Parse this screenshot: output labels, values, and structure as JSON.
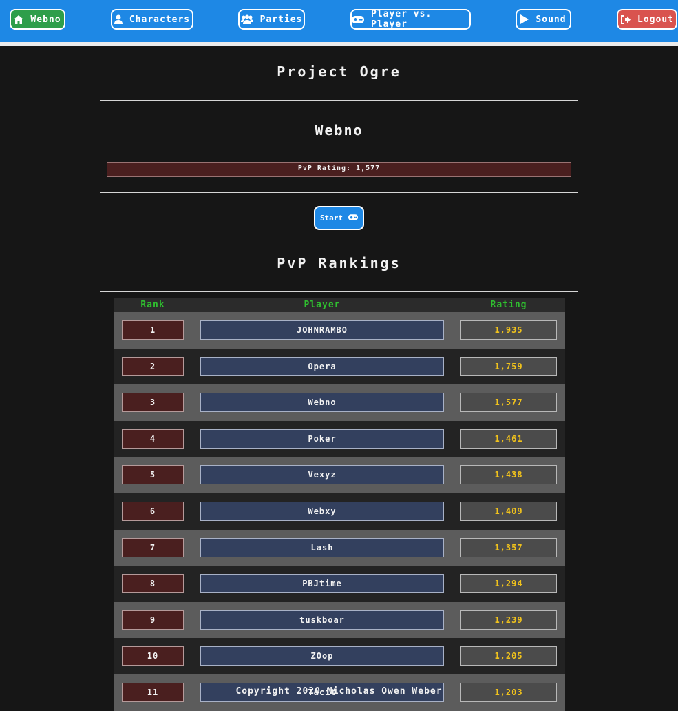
{
  "nav": {
    "home": {
      "label": "Webno",
      "icon": "home-icon"
    },
    "characters": {
      "label": "Characters",
      "icon": "user-icon"
    },
    "parties": {
      "label": "Parties",
      "icon": "users-icon"
    },
    "pvp": {
      "label": "Player vs. Player",
      "icon": "gamepad-icon"
    },
    "sound": {
      "label": "Sound",
      "icon": "play-icon"
    },
    "logout": {
      "label": "Logout",
      "icon": "sign-out-icon"
    }
  },
  "page": {
    "title": "Project Ogre",
    "character_name": "Webno",
    "rating_label": "PvP Rating: 1,577",
    "start_label": "Start",
    "rankings_title": "PvP Rankings"
  },
  "table": {
    "headers": {
      "rank": "Rank",
      "player": "Player",
      "rating": "Rating"
    },
    "rows": [
      {
        "rank": "1",
        "player": "JOHNRAMBO",
        "rating": "1,935"
      },
      {
        "rank": "2",
        "player": "Opera",
        "rating": "1,759"
      },
      {
        "rank": "3",
        "player": "Webno",
        "rating": "1,577"
      },
      {
        "rank": "4",
        "player": "Poker",
        "rating": "1,461"
      },
      {
        "rank": "5",
        "player": "Vexyz",
        "rating": "1,438"
      },
      {
        "rank": "6",
        "player": "Webxy",
        "rating": "1,409"
      },
      {
        "rank": "7",
        "player": "Lash",
        "rating": "1,357"
      },
      {
        "rank": "8",
        "player": "PBJtime",
        "rating": "1,294"
      },
      {
        "rank": "9",
        "player": "tuskboar",
        "rating": "1,239"
      },
      {
        "rank": "10",
        "player": "ZOop",
        "rating": "1,205"
      },
      {
        "rank": "11",
        "player": "Tacit",
        "rating": "1,203"
      }
    ]
  },
  "footer": {
    "copyright": "Copyright 2020 Nicholas Owen Weber"
  },
  "colors": {
    "nav_blue": "#1e88e5",
    "home_green": "#2e9e4a",
    "logout_red": "#d9534f",
    "header_green": "#2fbe2f",
    "rating_gold": "#f0c21c"
  }
}
